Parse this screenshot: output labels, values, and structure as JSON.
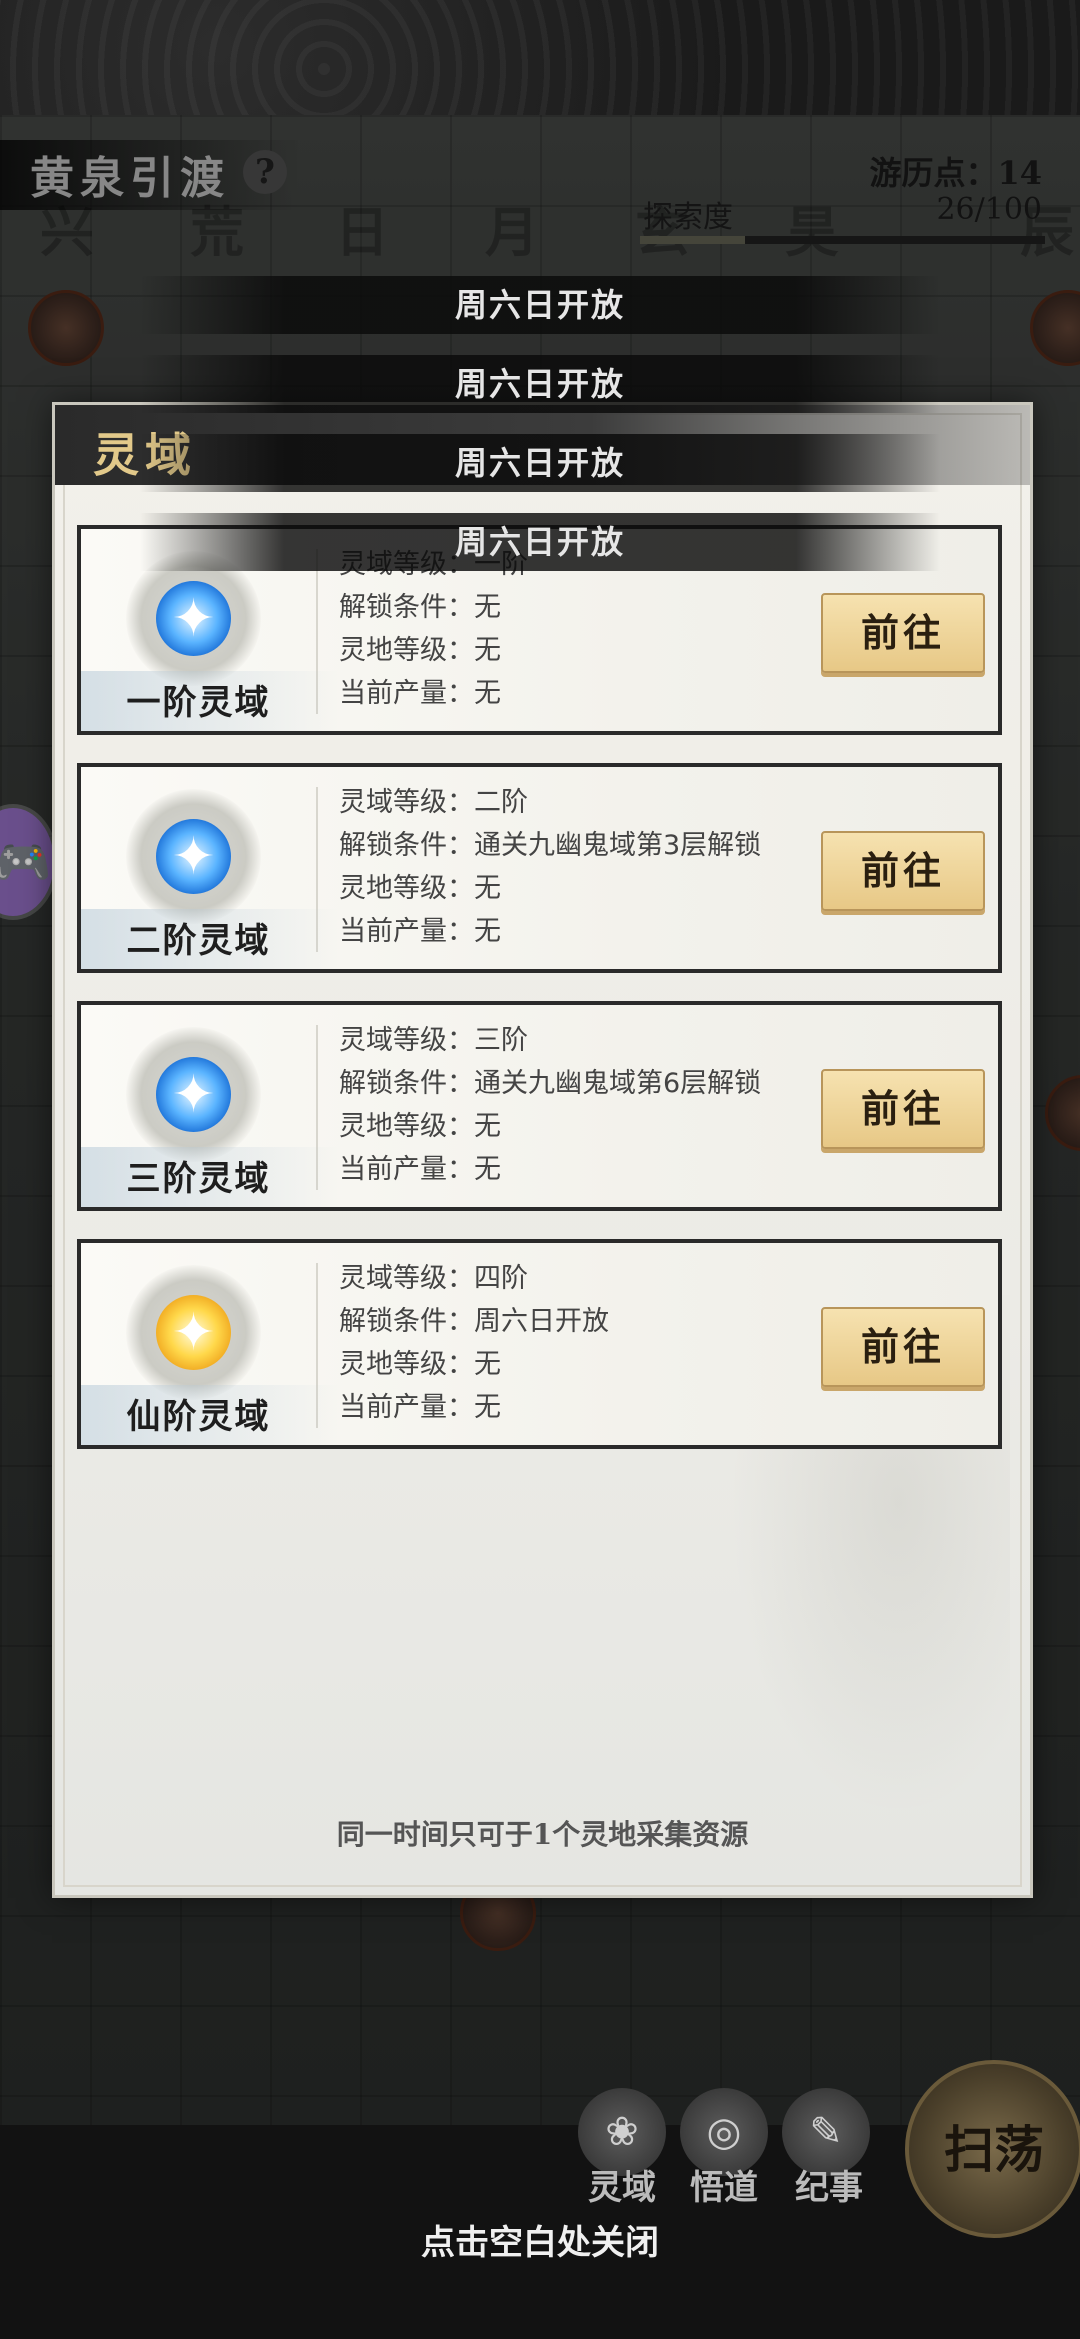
{
  "background": {
    "title": "黄泉引渡",
    "help_label": "?",
    "weekday_chars": [
      "兴",
      "荒",
      "日",
      "月",
      "玄",
      "昊",
      "辰"
    ],
    "points_label": "游历点：14",
    "explore_label": "探索度",
    "explore_value": "26/100",
    "explore_progress": 0.26,
    "bottom_nav": [
      {
        "label": "灵域",
        "icon": "lotus-icon"
      },
      {
        "label": "悟道",
        "icon": "swirl-icon"
      },
      {
        "label": "纪事",
        "icon": "book-icon"
      }
    ],
    "sweep_label": "扫荡",
    "close_hint": "点击空白处关闭"
  },
  "toasts": [
    "周六日开放",
    "周六日开放",
    "周六日开放",
    "周六日开放"
  ],
  "panel": {
    "title": "灵域",
    "footer_note": "同一时间只可于1个灵地采集资源",
    "cards": [
      {
        "name": "一阶灵域",
        "orb": "blue",
        "rows": [
          "灵域等级：一阶",
          "解锁条件：无",
          "灵地等级：无",
          "当前产量：无"
        ],
        "button": "前往"
      },
      {
        "name": "二阶灵域",
        "orb": "blue",
        "rows": [
          "灵域等级：二阶",
          "解锁条件：通关九幽鬼域第3层解锁",
          "灵地等级：无",
          "当前产量：无"
        ],
        "button": "前往"
      },
      {
        "name": "三阶灵域",
        "orb": "blue",
        "rows": [
          "灵域等级：三阶",
          "解锁条件：通关九幽鬼域第6层解锁",
          "灵地等级：无",
          "当前产量：无"
        ],
        "button": "前往"
      },
      {
        "name": "仙阶灵域",
        "orb": "gold",
        "rows": [
          "灵域等级：四阶",
          "解锁条件：周六日开放",
          "灵地等级：无",
          "当前产量：无"
        ],
        "button": "前往"
      }
    ]
  },
  "colors": {
    "panel_title": "#e2c98a",
    "button_gold": "#e7c886",
    "orb_blue": "#5ab4ff",
    "orb_gold": "#ffd84a"
  }
}
